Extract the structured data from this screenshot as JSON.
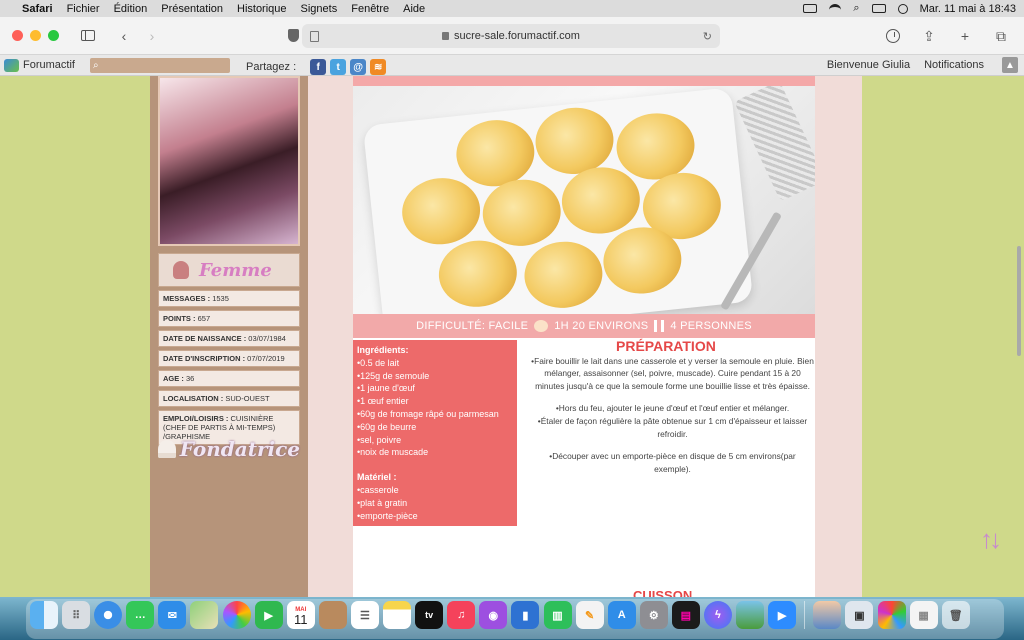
{
  "menubar": {
    "app": "Safari",
    "items": [
      "Fichier",
      "Édition",
      "Présentation",
      "Historique",
      "Signets",
      "Fenêtre",
      "Aide"
    ],
    "datetime": "Mar. 11 mai à 18:43"
  },
  "browser": {
    "url": "sucre-sale.forumactif.com"
  },
  "forumbar": {
    "brand": "Forumactif",
    "share_label": "Partagez :",
    "welcome": "Bienvenue Giulia",
    "notifications": "Notifications"
  },
  "profile": {
    "gender": "Femme",
    "fields": [
      {
        "label": "Messages :",
        "value": "1535"
      },
      {
        "label": "Points :",
        "value": "657"
      },
      {
        "label": "Date de naissance :",
        "value": "03/07/1984"
      },
      {
        "label": "Date d'inscription :",
        "value": "07/07/2019"
      },
      {
        "label": "Age :",
        "value": "36"
      },
      {
        "label": "Localisation :",
        "value": "SUD-OUEST"
      },
      {
        "label": "Emploi/loisirs :",
        "value": "CUISINIÈRE (CHEF DE PARTIS À MI-TEMPS) /GRAPHISME"
      }
    ],
    "role": "Fondatrice"
  },
  "recipe": {
    "difficulty": "Difficulté: Facile",
    "time": "1H 20 environs",
    "people": "4 personnes",
    "ingredients_title": "Ingrédients:",
    "ingredients": [
      "•0.5 de lait",
      "•125g de semoule",
      "•1 jaune d'œuf",
      "•1 œuf entier",
      "•60g de fromage râpé ou parmesan",
      "•60g de beurre",
      "•sel, poivre",
      "•noix de muscade"
    ],
    "materiel_title": "Matériel :",
    "materiel": [
      "•casserole",
      "•plat à gratin",
      "•emporte-pièce"
    ],
    "prep_title": "PRÉPARATION",
    "prep_steps": [
      "•Faire bouillir le lait dans une casserole et y verser la semoule en pluie. Bien mélanger, assaisonner (sel, poivre, muscade). Cuire pendant 15 à 20 minutes jusqu'à ce que la semoule forme une bouillie lisse et très épaisse.",
      "•Hors du feu, ajouter le jeune d'œuf et l'œuf entier et mélanger.",
      "•Étaler de façon régulière la pâte obtenue sur 1 cm d'épaisseur et laisser refroidir.",
      "•Découper avec un emporte-pièce en disque de 5 cm environs(par exemple)."
    ],
    "next_title": "CUISSON"
  },
  "dock": {
    "calendar_month": "MAI",
    "calendar_day": "11",
    "apps": [
      "finder-icon",
      "launchpad-icon",
      "safari-icon",
      "messages-icon",
      "mail-icon",
      "maps-icon",
      "photos-icon",
      "facetime-icon",
      "calendar-icon",
      "contacts-icon",
      "reminders-icon",
      "notes-icon",
      "tv-icon",
      "music-icon",
      "podcasts-icon",
      "keynote-icon",
      "numbers-icon",
      "pages-icon",
      "appstore-icon",
      "settings-icon",
      "soundboard-icon",
      "messenger-icon",
      "game-icon",
      "zoom-icon",
      "preview-icon",
      "photo-booth-icon",
      "candy-icon",
      "document-icon",
      "trash-icon"
    ]
  }
}
